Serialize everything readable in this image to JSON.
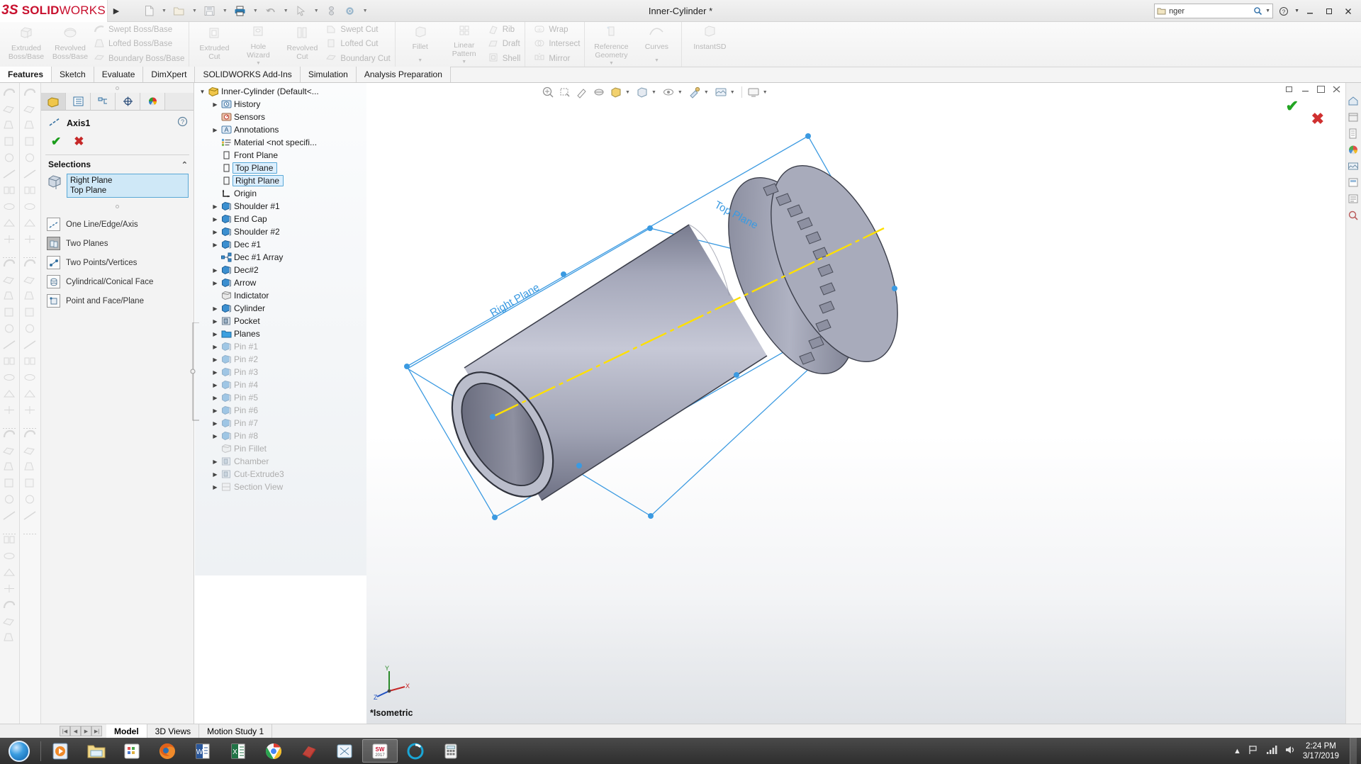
{
  "titlebar": {
    "logo_ds": "3S",
    "logo_solid": "SOLID",
    "logo_works": "WORKS",
    "document_title": "Inner-Cylinder *",
    "icons": [
      "new-document-icon",
      "open-folder-icon",
      "save-icon",
      "print-icon",
      "undo-icon",
      "select-pointer-icon",
      "rebuild-icon",
      "options-gear-icon"
    ],
    "search_placeholder": "nger",
    "search_value": "nger",
    "window_buttons": [
      "help-icon",
      "minimize-icon",
      "restore-icon",
      "close-icon"
    ]
  },
  "ribbon": {
    "groups": [
      {
        "big": [
          {
            "label1": "Extruded",
            "label2": "Boss/Base",
            "icon": "extruded-boss-icon"
          },
          {
            "label1": "Revolved",
            "label2": "Boss/Base",
            "icon": "revolved-boss-icon"
          }
        ],
        "small": [
          {
            "label": "Swept Boss/Base",
            "icon": "swept-boss-icon"
          },
          {
            "label": "Lofted Boss/Base",
            "icon": "lofted-boss-icon"
          },
          {
            "label": "Boundary Boss/Base",
            "icon": "boundary-boss-icon"
          }
        ]
      },
      {
        "big": [
          {
            "label1": "Extruded",
            "label2": "Cut",
            "icon": "extruded-cut-icon"
          },
          {
            "label1": "Hole",
            "label2": "Wizard",
            "icon": "hole-wizard-icon",
            "caret": true
          },
          {
            "label1": "Revolved",
            "label2": "Cut",
            "icon": "revolved-cut-icon"
          }
        ],
        "small": [
          {
            "label": "Swept Cut",
            "icon": "swept-cut-icon"
          },
          {
            "label": "Lofted Cut",
            "icon": "lofted-cut-icon"
          },
          {
            "label": "Boundary Cut",
            "icon": "boundary-cut-icon"
          }
        ]
      },
      {
        "big": [
          {
            "label1": "Fillet",
            "label2": "",
            "icon": "fillet-icon",
            "caret": true
          },
          {
            "label1": "Linear",
            "label2": "Pattern",
            "icon": "linear-pattern-icon",
            "caret": true
          }
        ],
        "small": [
          {
            "label": "Rib",
            "icon": "rib-icon"
          },
          {
            "label": "Draft",
            "icon": "draft-icon"
          },
          {
            "label": "Shell",
            "icon": "shell-icon"
          }
        ]
      },
      {
        "big": [],
        "small": [
          {
            "label": "Wrap",
            "icon": "wrap-icon"
          },
          {
            "label": "Intersect",
            "icon": "intersect-icon"
          },
          {
            "label": "Mirror",
            "icon": "mirror-icon"
          }
        ]
      },
      {
        "big": [
          {
            "label1": "Reference",
            "label2": "Geometry",
            "icon": "reference-geometry-icon",
            "caret": true
          },
          {
            "label1": "Curves",
            "label2": "",
            "icon": "curves-icon",
            "caret": true
          }
        ],
        "small": []
      },
      {
        "big": [
          {
            "label1": "InstantSD",
            "label2": "",
            "icon": "instant3d-icon"
          }
        ],
        "small": []
      }
    ]
  },
  "tabs": [
    {
      "label": "Features",
      "active": true
    },
    {
      "label": "Sketch",
      "active": false
    },
    {
      "label": "Evaluate",
      "active": false
    },
    {
      "label": "DimXpert",
      "active": false
    },
    {
      "label": "SOLIDWORKS Add-Ins",
      "active": false
    },
    {
      "label": "Simulation",
      "active": false
    },
    {
      "label": "Analysis Preparation",
      "active": false
    }
  ],
  "property_manager": {
    "tabs": [
      "feature-manager-tab",
      "property-manager-tab",
      "configuration-manager-tab",
      "dimxpert-manager-tab",
      "display-manager-tab"
    ],
    "title": "Axis1",
    "title_icon": "axis-icon",
    "help_icon": "help-circle-icon",
    "ok_icon": "green-check-icon",
    "cancel_icon": "red-x-icon",
    "section_label": "Selections",
    "selection_icon": "plane-cube-icon",
    "selection_items": [
      "Right Plane",
      "Top Plane"
    ],
    "options": [
      {
        "label": "One Line/Edge/Axis",
        "icon": "one-line-edge-axis-icon",
        "pressed": false
      },
      {
        "label": "Two Planes",
        "icon": "two-planes-icon",
        "pressed": true
      },
      {
        "label": "Two Points/Vertices",
        "icon": "two-points-vertices-icon",
        "pressed": false
      },
      {
        "label": "Cylindrical/Conical Face",
        "icon": "cylindrical-conical-face-icon",
        "pressed": false
      },
      {
        "label": "Point and Face/Plane",
        "icon": "point-and-face-plane-icon",
        "pressed": false
      }
    ]
  },
  "feature_tree": [
    {
      "label": "Inner-Cylinder  (Default<...",
      "icon": "part-icon",
      "indent": 0,
      "arrow": "down",
      "dim": false,
      "selected": false
    },
    {
      "label": "History",
      "icon": "history-icon",
      "indent": 1,
      "arrow": "right",
      "dim": false,
      "selected": false
    },
    {
      "label": "Sensors",
      "icon": "sensors-icon",
      "indent": 1,
      "arrow": "",
      "dim": false,
      "selected": false
    },
    {
      "label": "Annotations",
      "icon": "annotations-icon",
      "indent": 1,
      "arrow": "right",
      "dim": false,
      "selected": false
    },
    {
      "label": "Material <not specifi...",
      "icon": "material-icon",
      "indent": 1,
      "arrow": "",
      "dim": false,
      "selected": false
    },
    {
      "label": "Front Plane",
      "icon": "plane-icon",
      "indent": 1,
      "arrow": "",
      "dim": false,
      "selected": false
    },
    {
      "label": "Top Plane",
      "icon": "plane-icon",
      "indent": 1,
      "arrow": "",
      "dim": false,
      "selected": true
    },
    {
      "label": "Right Plane",
      "icon": "plane-icon",
      "indent": 1,
      "arrow": "",
      "dim": false,
      "selected": true
    },
    {
      "label": "Origin",
      "icon": "origin-icon",
      "indent": 1,
      "arrow": "",
      "dim": false,
      "selected": false
    },
    {
      "label": "Shoulder #1",
      "icon": "feature-icon",
      "indent": 1,
      "arrow": "right",
      "dim": false,
      "selected": false
    },
    {
      "label": "End Cap",
      "icon": "feature-icon",
      "indent": 1,
      "arrow": "right",
      "dim": false,
      "selected": false
    },
    {
      "label": "Shoulder #2",
      "icon": "feature-icon",
      "indent": 1,
      "arrow": "right",
      "dim": false,
      "selected": false
    },
    {
      "label": "Dec #1",
      "icon": "feature-icon",
      "indent": 1,
      "arrow": "right",
      "dim": false,
      "selected": false
    },
    {
      "label": "Dec #1 Array",
      "icon": "pattern-icon",
      "indent": 1,
      "arrow": "",
      "dim": false,
      "selected": false
    },
    {
      "label": "Dec#2",
      "icon": "feature-icon",
      "indent": 1,
      "arrow": "right",
      "dim": false,
      "selected": false
    },
    {
      "label": "Arrow",
      "icon": "feature-icon",
      "indent": 1,
      "arrow": "right",
      "dim": false,
      "selected": false
    },
    {
      "label": "Indictator",
      "icon": "grey-feature-icon",
      "indent": 1,
      "arrow": "",
      "dim": false,
      "selected": false
    },
    {
      "label": "Cylinder",
      "icon": "feature-icon",
      "indent": 1,
      "arrow": "right",
      "dim": false,
      "selected": false
    },
    {
      "label": "Pocket",
      "icon": "cut-feature-icon",
      "indent": 1,
      "arrow": "right",
      "dim": false,
      "selected": false
    },
    {
      "label": "Planes",
      "icon": "folder-icon",
      "indent": 1,
      "arrow": "right",
      "dim": false,
      "selected": false
    },
    {
      "label": "Pin #1",
      "icon": "feature-icon",
      "indent": 1,
      "arrow": "right",
      "dim": true,
      "selected": false
    },
    {
      "label": "Pin #2",
      "icon": "feature-icon",
      "indent": 1,
      "arrow": "right",
      "dim": true,
      "selected": false
    },
    {
      "label": "Pin #3",
      "icon": "feature-icon",
      "indent": 1,
      "arrow": "right",
      "dim": true,
      "selected": false
    },
    {
      "label": "Pin #4",
      "icon": "feature-icon",
      "indent": 1,
      "arrow": "right",
      "dim": true,
      "selected": false
    },
    {
      "label": "Pin #5",
      "icon": "feature-icon",
      "indent": 1,
      "arrow": "right",
      "dim": true,
      "selected": false
    },
    {
      "label": "Pin #6",
      "icon": "feature-icon",
      "indent": 1,
      "arrow": "right",
      "dim": true,
      "selected": false
    },
    {
      "label": "Pin #7",
      "icon": "feature-icon",
      "indent": 1,
      "arrow": "right",
      "dim": true,
      "selected": false
    },
    {
      "label": "Pin #8",
      "icon": "feature-icon",
      "indent": 1,
      "arrow": "right",
      "dim": true,
      "selected": false
    },
    {
      "label": "Pin Fillet",
      "icon": "grey-feature-icon",
      "indent": 1,
      "arrow": "",
      "dim": true,
      "selected": false
    },
    {
      "label": "Chamber",
      "icon": "cut-feature-icon",
      "indent": 1,
      "arrow": "right",
      "dim": true,
      "selected": false
    },
    {
      "label": "Cut-Extrude3",
      "icon": "cut-feature-icon",
      "indent": 1,
      "arrow": "right",
      "dim": true,
      "selected": false
    },
    {
      "label": "Section View",
      "icon": "section-view-icon",
      "indent": 1,
      "arrow": "right",
      "dim": true,
      "selected": false
    }
  ],
  "viewport": {
    "toolbar_icons": [
      "zoom-to-fit-icon",
      "zoom-to-area-icon",
      "previous-view-icon",
      "section-view-icon",
      "view-orientation-icon",
      "display-style-icon",
      "hide-show-items-icon",
      "edit-appearance-icon",
      "apply-scene-icon",
      "view-settings-icon"
    ],
    "window_buttons": [
      "restore-down-icon",
      "minimize-icon",
      "maximize-icon",
      "close-icon"
    ],
    "view_label": "*Isometric",
    "plane_label_right": "Right Plane",
    "plane_label_top": "Top Plane",
    "triad_axes": [
      "Y",
      "X",
      "Z"
    ],
    "colors": {
      "model_body": "#9a9cad",
      "model_highlight": "#c9cbd8",
      "plane_line": "#3b9ae1",
      "axis_line": "#ffe000",
      "edge": "#3a3a3a"
    }
  },
  "right_strip": {
    "icons": [
      "home-icon",
      "panel-icon",
      "new-doc-icon",
      "appearance-icon",
      "scene-icon",
      "decals-icon",
      "lights-icon",
      "custom-icon"
    ]
  },
  "doc_tabs": {
    "nav_buttons": [
      "first-icon",
      "prev-icon",
      "next-icon",
      "last-icon"
    ],
    "tabs": [
      {
        "label": "Model",
        "active": true
      },
      {
        "label": "3D Views",
        "active": false
      },
      {
        "label": "Motion Study 1",
        "active": false
      }
    ]
  },
  "taskbar": {
    "start_label": "start-orb-icon",
    "apps": [
      {
        "name": "media-player-icon",
        "active": false
      },
      {
        "name": "file-explorer-icon",
        "active": false
      },
      {
        "name": "app-grid-icon",
        "active": false
      },
      {
        "name": "firefox-icon",
        "active": false
      },
      {
        "name": "word-icon",
        "active": false
      },
      {
        "name": "excel-icon",
        "active": false
      },
      {
        "name": "chrome-icon",
        "active": false
      },
      {
        "name": "solidworks-app-icon",
        "active": false
      },
      {
        "name": "snipping-tool-icon",
        "active": false
      },
      {
        "name": "solidworks-2017-icon",
        "active": true
      },
      {
        "name": "cortana-icon",
        "active": false
      },
      {
        "name": "calculator-icon",
        "active": false
      }
    ],
    "tray_icons": [
      "show-hidden-icons-icon",
      "flag-action-center-icon",
      "network-icon",
      "volume-icon"
    ],
    "clock_time": "2:24 PM",
    "clock_date": "3/17/2019"
  }
}
